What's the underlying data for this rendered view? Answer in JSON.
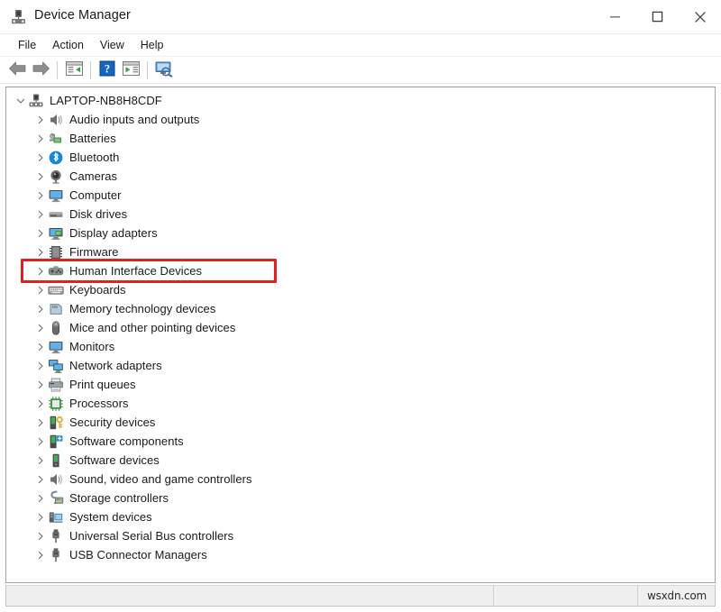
{
  "window": {
    "title": "Device Manager",
    "app_icon": "device-manager-icon",
    "controls": {
      "minimize_label": "–",
      "maximize_label": "□",
      "close_label": "✕"
    }
  },
  "menubar": {
    "items": [
      {
        "label": "File"
      },
      {
        "label": "Action"
      },
      {
        "label": "View"
      },
      {
        "label": "Help"
      }
    ]
  },
  "toolbar": {
    "buttons": [
      {
        "name": "back-button",
        "icon": "left-arrow-icon",
        "title": "Back"
      },
      {
        "name": "forward-button",
        "icon": "right-arrow-icon",
        "title": "Forward"
      },
      {
        "name": "properties-button",
        "icon": "properties-window-icon",
        "title": "Properties"
      },
      {
        "name": "help-button",
        "icon": "help-question-icon",
        "title": "Help"
      },
      {
        "name": "update-driver-button",
        "icon": "play-window-icon",
        "title": "Update driver"
      },
      {
        "name": "scan-hardware-button",
        "icon": "scan-monitor-icon",
        "title": "Scan for hardware changes"
      }
    ]
  },
  "tree": {
    "root": {
      "label": "LAPTOP-NB8H8CDF",
      "icon": "computer-root-icon",
      "expanded": true,
      "chevron": "∨"
    },
    "child_chevron": "›",
    "nodes": [
      {
        "label": "Audio inputs and outputs",
        "icon": "speaker-icon",
        "highlighted": false
      },
      {
        "label": "Batteries",
        "icon": "battery-icon",
        "highlighted": false
      },
      {
        "label": "Bluetooth",
        "icon": "bluetooth-icon",
        "highlighted": false
      },
      {
        "label": "Cameras",
        "icon": "camera-icon",
        "highlighted": false
      },
      {
        "label": "Computer",
        "icon": "monitor-icon",
        "highlighted": false
      },
      {
        "label": "Disk drives",
        "icon": "disk-drive-icon",
        "highlighted": false
      },
      {
        "label": "Display adapters",
        "icon": "display-adapter-icon",
        "highlighted": false
      },
      {
        "label": "Firmware",
        "icon": "firmware-chip-icon",
        "highlighted": false
      },
      {
        "label": "Human Interface Devices",
        "icon": "hid-gamepad-icon",
        "highlighted": true
      },
      {
        "label": "Keyboards",
        "icon": "keyboard-icon",
        "highlighted": false
      },
      {
        "label": "Memory technology devices",
        "icon": "memory-card-icon",
        "highlighted": false
      },
      {
        "label": "Mice and other pointing devices",
        "icon": "mouse-icon",
        "highlighted": false
      },
      {
        "label": "Monitors",
        "icon": "monitor-icon",
        "highlighted": false
      },
      {
        "label": "Network adapters",
        "icon": "network-adapter-icon",
        "highlighted": false
      },
      {
        "label": "Print queues",
        "icon": "printer-icon",
        "highlighted": false
      },
      {
        "label": "Processors",
        "icon": "processor-chip-icon",
        "highlighted": false
      },
      {
        "label": "Security devices",
        "icon": "security-key-icon",
        "highlighted": false
      },
      {
        "label": "Software components",
        "icon": "software-component-icon",
        "highlighted": false
      },
      {
        "label": "Software devices",
        "icon": "software-device-icon",
        "highlighted": false
      },
      {
        "label": "Sound, video and game controllers",
        "icon": "speaker-icon",
        "highlighted": false
      },
      {
        "label": "Storage controllers",
        "icon": "storage-controller-icon",
        "highlighted": false
      },
      {
        "label": "System devices",
        "icon": "system-device-icon",
        "highlighted": false
      },
      {
        "label": "Universal Serial Bus controllers",
        "icon": "usb-icon",
        "highlighted": false
      },
      {
        "label": "USB Connector Managers",
        "icon": "usb-icon",
        "highlighted": false
      }
    ]
  },
  "highlight": {
    "color": "#e81e25",
    "target_label": "Human Interface Devices"
  },
  "statusbar": {
    "pane1": "",
    "pane2": "",
    "watermark": "wsxdn.com"
  }
}
